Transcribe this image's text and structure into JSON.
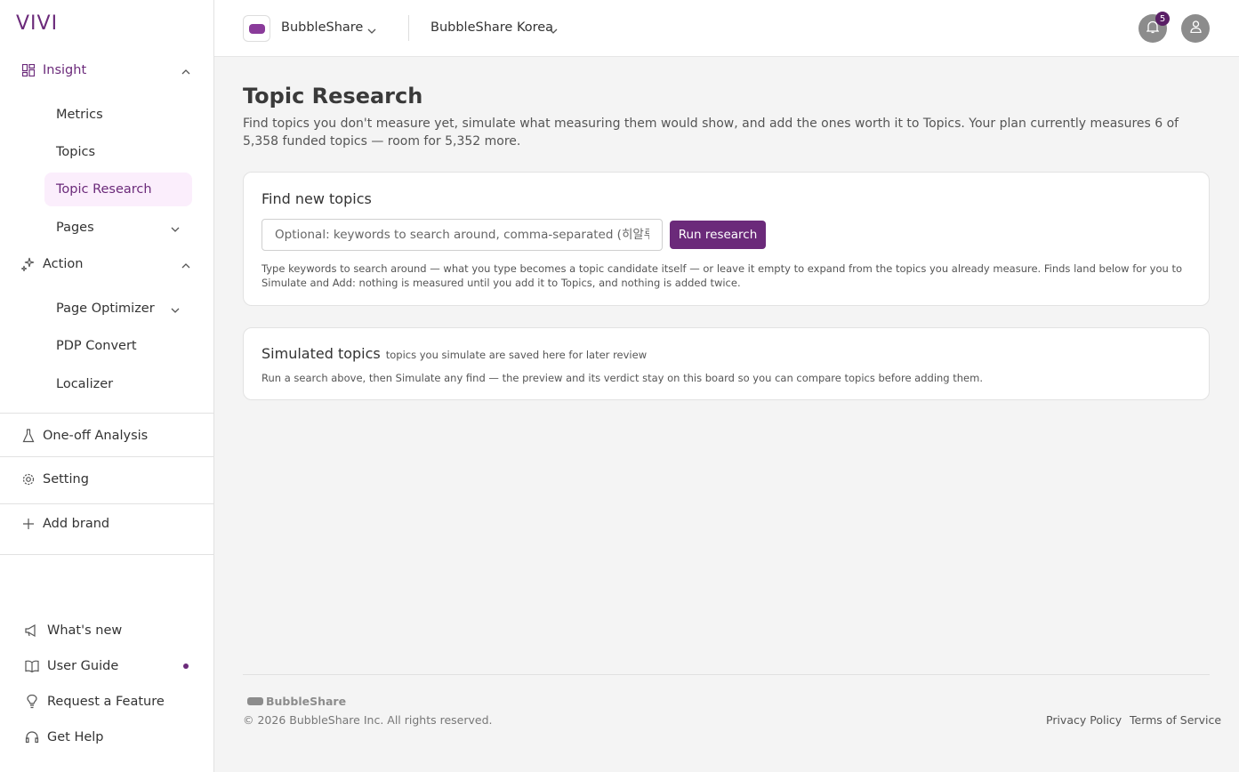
{
  "app": {
    "logo": "VIVI"
  },
  "colors": {
    "accent": "#6b2a7a",
    "selected_bg": "#fbeefc",
    "badge": "#5a1f66"
  },
  "sidebar": {
    "insight": {
      "label": "Insight",
      "icon": "grid-icon",
      "items": [
        "Metrics",
        "Topics",
        "Topic Research",
        "Pages"
      ],
      "selected": "Topic Research"
    },
    "action": {
      "label": "Action",
      "icon": "sparkle-icon",
      "items": [
        "Page Optimizer",
        "PDP Convert",
        "Localizer"
      ]
    },
    "one_off": {
      "label": "One-off Analysis",
      "icon": "flask-icon"
    },
    "setting": {
      "label": "Setting",
      "icon": "gear-icon"
    },
    "add_brand": {
      "label": "Add brand",
      "icon": "plus-icon"
    },
    "bottom": [
      {
        "label": "What's new",
        "icon": "megaphone-icon"
      },
      {
        "label": "User Guide",
        "icon": "book-icon"
      },
      {
        "label": "Request a Feature",
        "icon": "lightbulb-icon"
      },
      {
        "label": "Get Help",
        "icon": "headset-icon"
      }
    ]
  },
  "topbar": {
    "brand": "BubbleShare",
    "region": "BubbleShare Korea",
    "notification_count": "5"
  },
  "main": {
    "title": "Topic Research",
    "description": "Find topics you don't measure yet, simulate what measuring them would show, and add the ones worth it to Topics. Your plan currently measures 6 of 5,358 funded topics — room for 5,352 more.",
    "find": {
      "title": "Find new topics",
      "placeholder": "Optional: keywords to search around, comma-separated (히알루론산, 수분크림)",
      "button": "Run research",
      "help": "Type keywords to search around — what you type becomes a topic candidate itself — or leave it empty to expand from the topics you already measure. Finds land below for you to Simulate and Add: nothing is measured until you add it to Topics, and nothing is added twice."
    },
    "simulated": {
      "title": "Simulated topics",
      "note": "topics you simulate are saved here for later review",
      "text": "Run a search above, then Simulate any find — the preview and its verdict stay on this board so you can compare topics before adding them."
    }
  },
  "footer": {
    "logo": "BubbleShare",
    "copyright": "© 2026 BubbleShare Inc. All rights reserved.",
    "privacy": "Privacy Policy",
    "terms": "Terms of Service"
  }
}
